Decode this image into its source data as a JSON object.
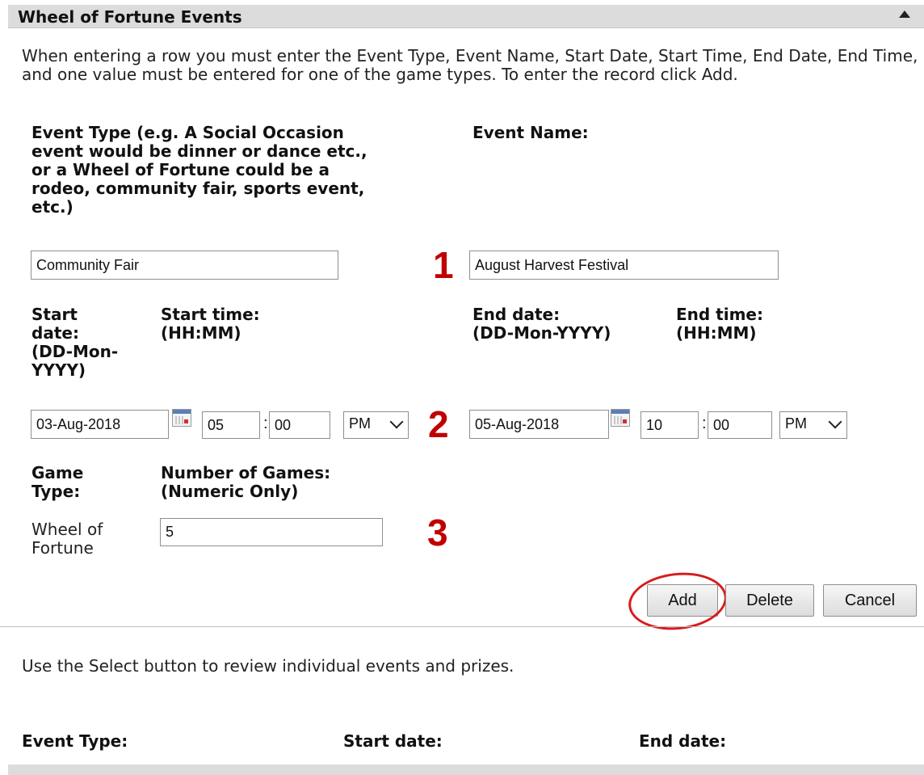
{
  "panel": {
    "title": "Wheel of Fortune Events"
  },
  "intro_text": "When entering a row you must enter the Event Type, Event Name, Start Date, Start Time, End Date, End Time, and one value must be entered for one of the game types. To enter the record click Add.",
  "event_type": {
    "label_lines": [
      "Event Type (e.g. A Social Occasion",
      "event would be dinner or dance etc.,",
      "or a Wheel of Fortune could be a",
      "rodeo, community fair, sports event,",
      "etc.)"
    ],
    "value": "Community Fair"
  },
  "event_name": {
    "label": "Event Name:",
    "value": "August Harvest Festival"
  },
  "start_date": {
    "label_lines": [
      "Start",
      "date:",
      "(DD-Mon-",
      "YYYY)"
    ],
    "value": "03-Aug-2018"
  },
  "start_time": {
    "label_lines": [
      "Start time:",
      "(HH:MM)"
    ],
    "hour": "05",
    "minute": "00",
    "ampm": "PM"
  },
  "end_date": {
    "label_lines": [
      "End date:",
      "(DD-Mon-YYYY)"
    ],
    "value": "05-Aug-2018"
  },
  "end_time": {
    "label_lines": [
      "End time:",
      "(HH:MM)"
    ],
    "hour": "10",
    "minute": "00",
    "ampm": "PM"
  },
  "game": {
    "type_label_lines": [
      "Game",
      "Type:"
    ],
    "count_label_lines": [
      "Number of Games:",
      "(Numeric Only)"
    ],
    "type_value_lines": [
      "Wheel of",
      "Fortune"
    ],
    "count_value": "5"
  },
  "annotations": [
    "1",
    "2",
    "3"
  ],
  "buttons": {
    "add": "Add",
    "delete": "Delete",
    "cancel": "Cancel"
  },
  "select_hint": "Use the Select button to review individual events and prizes.",
  "list_headers": {
    "event_type": "Event Type:",
    "start_date": "Start date:",
    "end_date": "End date:"
  },
  "icons": {
    "collapse": "collapse-up-icon",
    "calendar": "calendar-icon",
    "dropdown": "chevron-down-icon"
  },
  "colors": {
    "annotation": "#c00000",
    "highlight_circle": "#d81b1b",
    "header_bg": "#dcdcdc"
  }
}
